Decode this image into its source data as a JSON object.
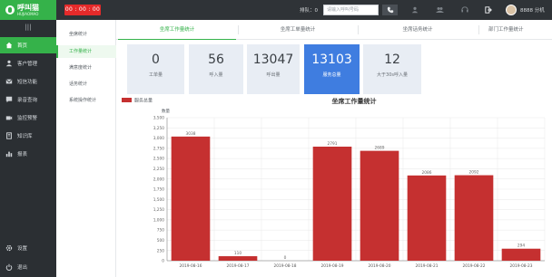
{
  "topbar": {
    "logo_text": "呼叫猫",
    "logo_sub": "HUJIAOMAO",
    "timer": "00 : 00 : 00",
    "queue_label": "排队：",
    "queue_count": "0",
    "dial_placeholder": "请输入呼叫号码",
    "user_name": "8888 分机"
  },
  "sidebar": {
    "items": [
      {
        "label": "首页",
        "icon": "home-icon"
      },
      {
        "label": "客户管理",
        "icon": "user-icon"
      },
      {
        "label": "短信功能",
        "icon": "mail-icon"
      },
      {
        "label": "录音查询",
        "icon": "chat-icon"
      },
      {
        "label": "监控预警",
        "icon": "camera-icon"
      },
      {
        "label": "知识库",
        "icon": "book-icon"
      },
      {
        "label": "报表",
        "icon": "chart-icon"
      }
    ],
    "settings_label": "设置",
    "logout_label": "退出"
  },
  "subnav": {
    "items": [
      "坐席统计",
      "工作量统计",
      "满意度统计",
      "话务统计",
      "系统操作统计"
    ]
  },
  "tabs": [
    "坐席工作量统计",
    "坐席工单量统计",
    "坐席话务统计",
    "部门工作量统计"
  ],
  "stats": [
    {
      "value": "0",
      "label": "工单量"
    },
    {
      "value": "56",
      "label": "呼入量"
    },
    {
      "value": "13047",
      "label": "呼出量"
    },
    {
      "value": "13103",
      "label": "服务总量"
    },
    {
      "value": "12",
      "label": "大于30s呼入量"
    }
  ],
  "colors": {
    "accent": "#35b24a",
    "highlight": "#3f7de0",
    "bar": "#c53030",
    "timer": "#e52a2a"
  },
  "chart_data": {
    "type": "bar",
    "title": "坐席工作量统计",
    "ylabel": "数量",
    "legend": "服务总量",
    "legend_position": "top-left",
    "categories": [
      "2019-08-16",
      "2019-08-17",
      "2019-08-18",
      "2019-08-19",
      "2019-08-20",
      "2019-08-21",
      "2019-08-22",
      "2019-08-23"
    ],
    "values": [
      3038,
      110,
      0,
      2791,
      2689,
      2086,
      2092,
      294
    ],
    "ylim": [
      0,
      3500
    ],
    "yticks": [
      0,
      250,
      500,
      750,
      1000,
      1250,
      1500,
      1750,
      2000,
      2250,
      2500,
      2750,
      3000,
      3250,
      3500
    ],
    "ytick_labels": [
      "0",
      "250",
      "500",
      "750",
      "1,000",
      "1,250",
      "1,500",
      "1,750",
      "2,000",
      "2,250",
      "2,500",
      "2,750",
      "3,000",
      "3,250",
      "3,500"
    ],
    "grid": true
  }
}
